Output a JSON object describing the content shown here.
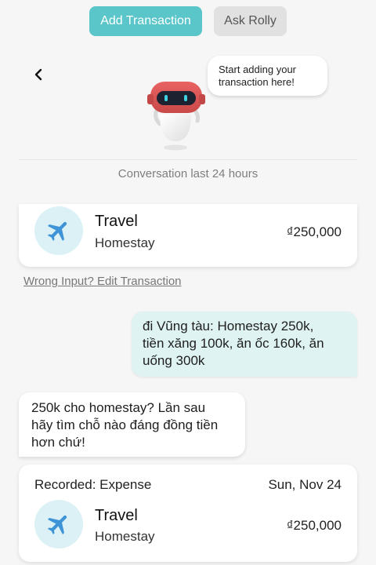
{
  "tabs": {
    "add": "Add Transaction",
    "ask": "Ask Rolly"
  },
  "assistant": {
    "bubble_lines": [
      "Start adding your",
      "transaction here!"
    ]
  },
  "conversation_label": "Conversation last 24 hours",
  "transactions": [
    {
      "category": "Travel",
      "subcategory": "Homestay",
      "amount": "₫250,000",
      "icon": "airplane-icon"
    }
  ],
  "edit_link": "Wrong Input? Edit Transaction",
  "messages": {
    "user_lines": [
      "đi Vũng tàu: Homestay 250k,",
      "tiền xăng 100k, ăn ốc 160k, ăn",
      "uống 300k"
    ],
    "bot_lines": [
      "250k cho homestay? Lần sau",
      "hãy tìm chỗ nào đáng đồng tiền",
      "hơn chứ!"
    ]
  },
  "recorded": {
    "title": "Recorded: Expense",
    "date": "Sun, Nov 24",
    "category": "Travel",
    "subcategory": "Homestay",
    "amount": "₫250,000",
    "icon": "airplane-icon"
  },
  "colors": {
    "accent": "#5bc6c9",
    "icon_bg": "#dbf1f6",
    "user_bubble": "#dff3f2"
  }
}
